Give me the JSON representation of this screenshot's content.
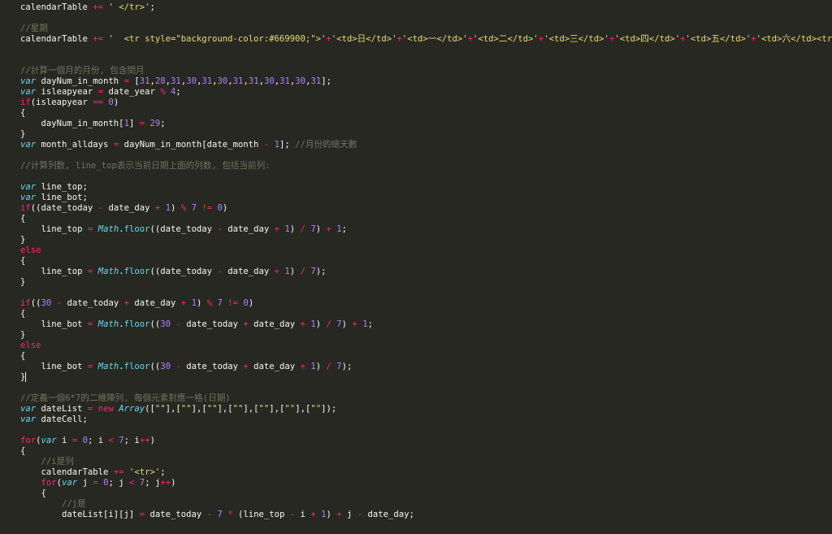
{
  "editor": {
    "theme_colors": {
      "background": "#272822",
      "plain": "#f8f8f2",
      "keyword": "#f92672",
      "storage": "#66d9ef",
      "number": "#ae81ff",
      "string": "#e6db74",
      "comment": "#75715e"
    },
    "lines": [
      [
        [
          "p",
          "calendarTable "
        ],
        [
          "o",
          "+="
        ],
        [
          "p",
          " "
        ],
        [
          "s",
          "' </tr>'"
        ],
        [
          "p",
          ";"
        ]
      ],
      [],
      [
        [
          "c",
          "//星期"
        ]
      ],
      [
        [
          "p",
          "calendarTable "
        ],
        [
          "o",
          "+="
        ],
        [
          "p",
          " "
        ],
        [
          "s",
          "'  <tr style=\"background-color:#669900;\">'"
        ],
        [
          "o",
          "+"
        ],
        [
          "s",
          "'<td>日</td>'"
        ],
        [
          "o",
          "+"
        ],
        [
          "s",
          "'<td>一</td>'"
        ],
        [
          "o",
          "+"
        ],
        [
          "s",
          "'<td>二</td>'"
        ],
        [
          "o",
          "+"
        ],
        [
          "s",
          "'<td>三</td>'"
        ],
        [
          "o",
          "+"
        ],
        [
          "s",
          "'<td>四</td>'"
        ],
        [
          "o",
          "+"
        ],
        [
          "s",
          "'<td>五</td>'"
        ],
        [
          "o",
          "+"
        ],
        [
          "s",
          "'<td>六</td><tr>'"
        ],
        [
          "p",
          ";"
        ]
      ],
      [],
      [],
      [
        [
          "c",
          "//計算一個月的月份, 包含閏月"
        ]
      ],
      [
        [
          "t",
          "var"
        ],
        [
          "p",
          " dayNum_in_month "
        ],
        [
          "o",
          "="
        ],
        [
          "p",
          " ["
        ],
        [
          "n",
          "31"
        ],
        [
          "p",
          ","
        ],
        [
          "n",
          "28"
        ],
        [
          "p",
          ","
        ],
        [
          "n",
          "31"
        ],
        [
          "p",
          ","
        ],
        [
          "n",
          "30"
        ],
        [
          "p",
          ","
        ],
        [
          "n",
          "31"
        ],
        [
          "p",
          ","
        ],
        [
          "n",
          "30"
        ],
        [
          "p",
          ","
        ],
        [
          "n",
          "31"
        ],
        [
          "p",
          ","
        ],
        [
          "n",
          "31"
        ],
        [
          "p",
          ","
        ],
        [
          "n",
          "30"
        ],
        [
          "p",
          ","
        ],
        [
          "n",
          "31"
        ],
        [
          "p",
          ","
        ],
        [
          "n",
          "30"
        ],
        [
          "p",
          ","
        ],
        [
          "n",
          "31"
        ],
        [
          "p",
          "];"
        ]
      ],
      [
        [
          "t",
          "var"
        ],
        [
          "p",
          " isleapyear "
        ],
        [
          "o",
          "="
        ],
        [
          "p",
          " date_year "
        ],
        [
          "o",
          "%"
        ],
        [
          "p",
          " "
        ],
        [
          "n",
          "4"
        ],
        [
          "p",
          ";"
        ]
      ],
      [
        [
          "k",
          "if"
        ],
        [
          "p",
          "(isleapyear "
        ],
        [
          "o",
          "=="
        ],
        [
          "p",
          " "
        ],
        [
          "n",
          "0"
        ],
        [
          "p",
          ")"
        ]
      ],
      [
        [
          "p",
          "{"
        ]
      ],
      [
        [
          "p",
          "    dayNum_in_month["
        ],
        [
          "n",
          "1"
        ],
        [
          "p",
          "] "
        ],
        [
          "o",
          "="
        ],
        [
          "p",
          " "
        ],
        [
          "n",
          "29"
        ],
        [
          "p",
          ";"
        ]
      ],
      [
        [
          "p",
          "}"
        ]
      ],
      [
        [
          "t",
          "var"
        ],
        [
          "p",
          " month_alldays "
        ],
        [
          "o",
          "="
        ],
        [
          "p",
          " dayNum_in_month[date_month "
        ],
        [
          "o",
          "-"
        ],
        [
          "p",
          " "
        ],
        [
          "n",
          "1"
        ],
        [
          "p",
          "]; "
        ],
        [
          "c",
          "//月份的總天數"
        ]
      ],
      [],
      [
        [
          "c",
          "//计算列数, line_top表示当前日期上面的列数, 包括当前列:"
        ]
      ],
      [],
      [
        [
          "t",
          "var"
        ],
        [
          "p",
          " line_top;"
        ]
      ],
      [
        [
          "t",
          "var"
        ],
        [
          "p",
          " line_bot;"
        ]
      ],
      [
        [
          "k",
          "if"
        ],
        [
          "p",
          "((date_today "
        ],
        [
          "o",
          "-"
        ],
        [
          "p",
          " date_day "
        ],
        [
          "o",
          "+"
        ],
        [
          "p",
          " "
        ],
        [
          "n",
          "1"
        ],
        [
          "p",
          ") "
        ],
        [
          "o",
          "%"
        ],
        [
          "p",
          " "
        ],
        [
          "n",
          "7"
        ],
        [
          "p",
          " "
        ],
        [
          "o",
          "!="
        ],
        [
          "p",
          " "
        ],
        [
          "n",
          "0"
        ],
        [
          "p",
          ")"
        ]
      ],
      [
        [
          "p",
          "{"
        ]
      ],
      [
        [
          "p",
          "    line_top "
        ],
        [
          "o",
          "="
        ],
        [
          "p",
          " "
        ],
        [
          "b",
          "Math"
        ],
        [
          "p",
          "."
        ],
        [
          "f",
          "floor"
        ],
        [
          "p",
          "((date_today "
        ],
        [
          "o",
          "-"
        ],
        [
          "p",
          " date_day "
        ],
        [
          "o",
          "+"
        ],
        [
          "p",
          " "
        ],
        [
          "n",
          "1"
        ],
        [
          "p",
          ") "
        ],
        [
          "o",
          "/"
        ],
        [
          "p",
          " "
        ],
        [
          "n",
          "7"
        ],
        [
          "p",
          ") "
        ],
        [
          "o",
          "+"
        ],
        [
          "p",
          " "
        ],
        [
          "n",
          "1"
        ],
        [
          "p",
          ";"
        ]
      ],
      [
        [
          "p",
          "}"
        ]
      ],
      [
        [
          "k",
          "else"
        ]
      ],
      [
        [
          "p",
          "{"
        ]
      ],
      [
        [
          "p",
          "    line_top "
        ],
        [
          "o",
          "="
        ],
        [
          "p",
          " "
        ],
        [
          "b",
          "Math"
        ],
        [
          "p",
          "."
        ],
        [
          "f",
          "floor"
        ],
        [
          "p",
          "((date_today "
        ],
        [
          "o",
          "-"
        ],
        [
          "p",
          " date_day "
        ],
        [
          "o",
          "+"
        ],
        [
          "p",
          " "
        ],
        [
          "n",
          "1"
        ],
        [
          "p",
          ") "
        ],
        [
          "o",
          "/"
        ],
        [
          "p",
          " "
        ],
        [
          "n",
          "7"
        ],
        [
          "p",
          ");"
        ]
      ],
      [
        [
          "p",
          "}"
        ]
      ],
      [],
      [
        [
          "k",
          "if"
        ],
        [
          "p",
          "(("
        ],
        [
          "n",
          "30"
        ],
        [
          "p",
          " "
        ],
        [
          "o",
          "-"
        ],
        [
          "p",
          " date_today "
        ],
        [
          "o",
          "+"
        ],
        [
          "p",
          " date_day "
        ],
        [
          "o",
          "+"
        ],
        [
          "p",
          " "
        ],
        [
          "n",
          "1"
        ],
        [
          "p",
          ") "
        ],
        [
          "o",
          "%"
        ],
        [
          "p",
          " "
        ],
        [
          "n",
          "7"
        ],
        [
          "p",
          " "
        ],
        [
          "o",
          "!="
        ],
        [
          "p",
          " "
        ],
        [
          "n",
          "0"
        ],
        [
          "p",
          ")"
        ]
      ],
      [
        [
          "p",
          "{"
        ]
      ],
      [
        [
          "p",
          "    line_bot "
        ],
        [
          "o",
          "="
        ],
        [
          "p",
          " "
        ],
        [
          "b",
          "Math"
        ],
        [
          "p",
          "."
        ],
        [
          "f",
          "floor"
        ],
        [
          "p",
          "(("
        ],
        [
          "n",
          "30"
        ],
        [
          "p",
          " "
        ],
        [
          "o",
          "-"
        ],
        [
          "p",
          " date_today "
        ],
        [
          "o",
          "+"
        ],
        [
          "p",
          " date_day "
        ],
        [
          "o",
          "+"
        ],
        [
          "p",
          " "
        ],
        [
          "n",
          "1"
        ],
        [
          "p",
          ") "
        ],
        [
          "o",
          "/"
        ],
        [
          "p",
          " "
        ],
        [
          "n",
          "7"
        ],
        [
          "p",
          ") "
        ],
        [
          "o",
          "+"
        ],
        [
          "p",
          " "
        ],
        [
          "n",
          "1"
        ],
        [
          "p",
          ";"
        ]
      ],
      [
        [
          "p",
          "}"
        ]
      ],
      [
        [
          "k",
          "else"
        ]
      ],
      [
        [
          "p",
          "{"
        ]
      ],
      [
        [
          "p",
          "    line_bot "
        ],
        [
          "o",
          "="
        ],
        [
          "p",
          " "
        ],
        [
          "b",
          "Math"
        ],
        [
          "p",
          "."
        ],
        [
          "f",
          "floor"
        ],
        [
          "p",
          "(("
        ],
        [
          "n",
          "30"
        ],
        [
          "p",
          " "
        ],
        [
          "o",
          "-"
        ],
        [
          "p",
          " date_today "
        ],
        [
          "o",
          "+"
        ],
        [
          "p",
          " date_day "
        ],
        [
          "o",
          "+"
        ],
        [
          "p",
          " "
        ],
        [
          "n",
          "1"
        ],
        [
          "p",
          ") "
        ],
        [
          "o",
          "/"
        ],
        [
          "p",
          " "
        ],
        [
          "n",
          "7"
        ],
        [
          "p",
          ");"
        ]
      ],
      [
        [
          "p",
          "}"
        ],
        [
          "cursor",
          ""
        ]
      ],
      [],
      [
        [
          "c",
          "//定義一個6*7的二維陣列, 每個元素對應一格(日期)"
        ]
      ],
      [
        [
          "t",
          "var"
        ],
        [
          "p",
          " dateList "
        ],
        [
          "o",
          "="
        ],
        [
          "p",
          " "
        ],
        [
          "k",
          "new"
        ],
        [
          "p",
          " "
        ],
        [
          "b",
          "Array"
        ],
        [
          "p",
          "(["
        ],
        [
          "s",
          "\"\""
        ],
        [
          "p",
          "],["
        ],
        [
          "s",
          "\"\""
        ],
        [
          "p",
          "],["
        ],
        [
          "s",
          "\"\""
        ],
        [
          "p",
          "],["
        ],
        [
          "s",
          "\"\""
        ],
        [
          "p",
          "],["
        ],
        [
          "s",
          "\"\""
        ],
        [
          "p",
          "],["
        ],
        [
          "s",
          "\"\""
        ],
        [
          "p",
          "],["
        ],
        [
          "s",
          "\"\""
        ],
        [
          "p",
          "]);"
        ]
      ],
      [
        [
          "t",
          "var"
        ],
        [
          "p",
          " dateCell;"
        ]
      ],
      [],
      [
        [
          "k",
          "for"
        ],
        [
          "p",
          "("
        ],
        [
          "t",
          "var"
        ],
        [
          "p",
          " i "
        ],
        [
          "o",
          "="
        ],
        [
          "p",
          " "
        ],
        [
          "n",
          "0"
        ],
        [
          "p",
          "; i "
        ],
        [
          "o",
          "<"
        ],
        [
          "p",
          " "
        ],
        [
          "n",
          "7"
        ],
        [
          "p",
          "; i"
        ],
        [
          "o",
          "++"
        ],
        [
          "p",
          ")"
        ]
      ],
      [
        [
          "p",
          "{"
        ]
      ],
      [
        [
          "p",
          "    "
        ],
        [
          "c",
          "//i是列"
        ]
      ],
      [
        [
          "p",
          "    calendarTable "
        ],
        [
          "o",
          "+="
        ],
        [
          "p",
          " "
        ],
        [
          "s",
          "'<tr>'"
        ],
        [
          "p",
          ";"
        ]
      ],
      [
        [
          "p",
          "    "
        ],
        [
          "k",
          "for"
        ],
        [
          "p",
          "("
        ],
        [
          "t",
          "var"
        ],
        [
          "p",
          " j "
        ],
        [
          "o",
          "="
        ],
        [
          "p",
          " "
        ],
        [
          "n",
          "0"
        ],
        [
          "p",
          "; j "
        ],
        [
          "o",
          "<"
        ],
        [
          "p",
          " "
        ],
        [
          "n",
          "7"
        ],
        [
          "p",
          "; j"
        ],
        [
          "o",
          "++"
        ],
        [
          "p",
          ")"
        ]
      ],
      [
        [
          "p",
          "    {"
        ]
      ],
      [
        [
          "p",
          "        "
        ],
        [
          "c",
          "//j是"
        ]
      ],
      [
        [
          "p",
          "        dateList[i][j] "
        ],
        [
          "o",
          "="
        ],
        [
          "p",
          " date_today "
        ],
        [
          "o",
          "-"
        ],
        [
          "p",
          " "
        ],
        [
          "n",
          "7"
        ],
        [
          "p",
          " "
        ],
        [
          "o",
          "*"
        ],
        [
          "p",
          " (line_top "
        ],
        [
          "o",
          "-"
        ],
        [
          "p",
          " i "
        ],
        [
          "o",
          "+"
        ],
        [
          "p",
          " "
        ],
        [
          "n",
          "1"
        ],
        [
          "p",
          ") "
        ],
        [
          "o",
          "+"
        ],
        [
          "p",
          " j "
        ],
        [
          "o",
          "-"
        ],
        [
          "p",
          " date_day;"
        ]
      ]
    ]
  }
}
